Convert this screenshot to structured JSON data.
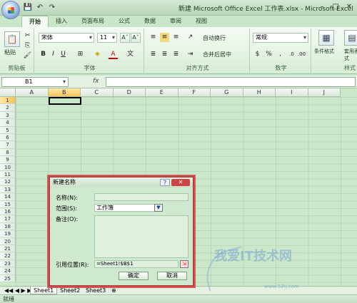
{
  "window": {
    "title": "新建 Microsoft Office Excel 工作表.xlsx - Microsoft Excel",
    "min": "–",
    "max": "□",
    "close": "✕"
  },
  "qat": {
    "save": "💾",
    "undo": "↶",
    "redo": "↷"
  },
  "tabs": [
    "开始",
    "插入",
    "页面布局",
    "公式",
    "数据",
    "审阅",
    "视图"
  ],
  "ribbon": {
    "clipboard": {
      "paste": "粘贴",
      "label": "剪贴板"
    },
    "font": {
      "name": "宋体",
      "size": "11",
      "label": "字体",
      "grow": "A˄",
      "shrink": "A˅",
      "bold": "B",
      "italic": "I",
      "underline": "U",
      "border": "⊞",
      "fill": "◈",
      "color": "A",
      "phonetic": "文"
    },
    "alignment": {
      "wrap": "自动换行",
      "merge": "合并后居中",
      "label": "对齐方式"
    },
    "number": {
      "format": "常规",
      "currency": "$",
      "percent": "%",
      "comma": ",",
      "inc": ".0",
      "dec": ".00",
      "label": "数字"
    },
    "styles": {
      "conditional": "条件格式",
      "table": "套用表格格式",
      "label": "样式"
    }
  },
  "formula_bar": {
    "name_box": "B1",
    "fx": "fx",
    "value": ""
  },
  "columns": [
    "A",
    "B",
    "C",
    "D",
    "E",
    "F",
    "G",
    "H",
    "I",
    "J"
  ],
  "rows": [
    "1",
    "2",
    "3",
    "4",
    "5",
    "6",
    "7",
    "8",
    "9",
    "10",
    "11",
    "12",
    "13",
    "14",
    "15",
    "16",
    "17",
    "18",
    "19",
    "20",
    "21",
    "22",
    "23",
    "24",
    "25"
  ],
  "sheets": [
    "Sheet1",
    "Sheet2",
    "Sheet3"
  ],
  "sheet_nav": "◀◀ ◀ ▶ ▶▶",
  "status": {
    "ready": "就绪"
  },
  "dialog": {
    "title": "新建名称",
    "help": "?",
    "close": "✕",
    "name_label": "名称(N):",
    "name_value": "",
    "scope_label": "范围(S):",
    "scope_value": "工作簿",
    "comment_label": "备注(O):",
    "ref_label": "引用位置(R):",
    "ref_value": "=Sheet1!$B$1",
    "ok": "确定",
    "cancel": "取消"
  },
  "watermark": {
    "text": "我爱IT技术网",
    "sub": "www.52ij.com"
  }
}
